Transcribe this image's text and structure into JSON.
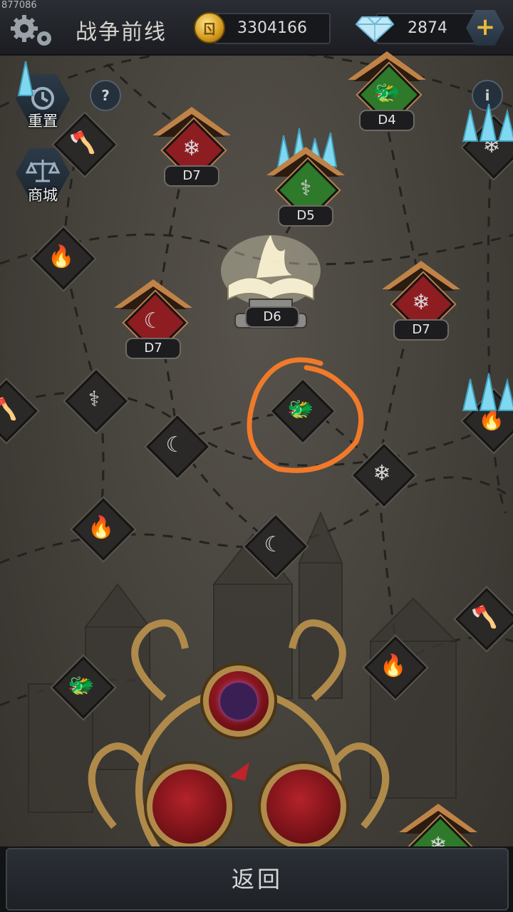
{
  "debug_id": "877086",
  "header": {
    "title": "战争前线",
    "gold": "3304166",
    "gems": "2874"
  },
  "side_buttons": {
    "reset_label": "重置",
    "shop_label": "商城",
    "help_label": "?",
    "info_label": "i"
  },
  "nodes": {
    "d4": "D4",
    "d5": "D5",
    "d6": "D6",
    "d7_left": "D7",
    "d7_mid": "D7",
    "d7_right": "D7"
  },
  "footer": {
    "back_label": "返回"
  },
  "colors": {
    "highlight": "#f07a2a",
    "red_node": "#8e1d22",
    "green_node": "#2f7a2a",
    "roof": "#c08347"
  }
}
